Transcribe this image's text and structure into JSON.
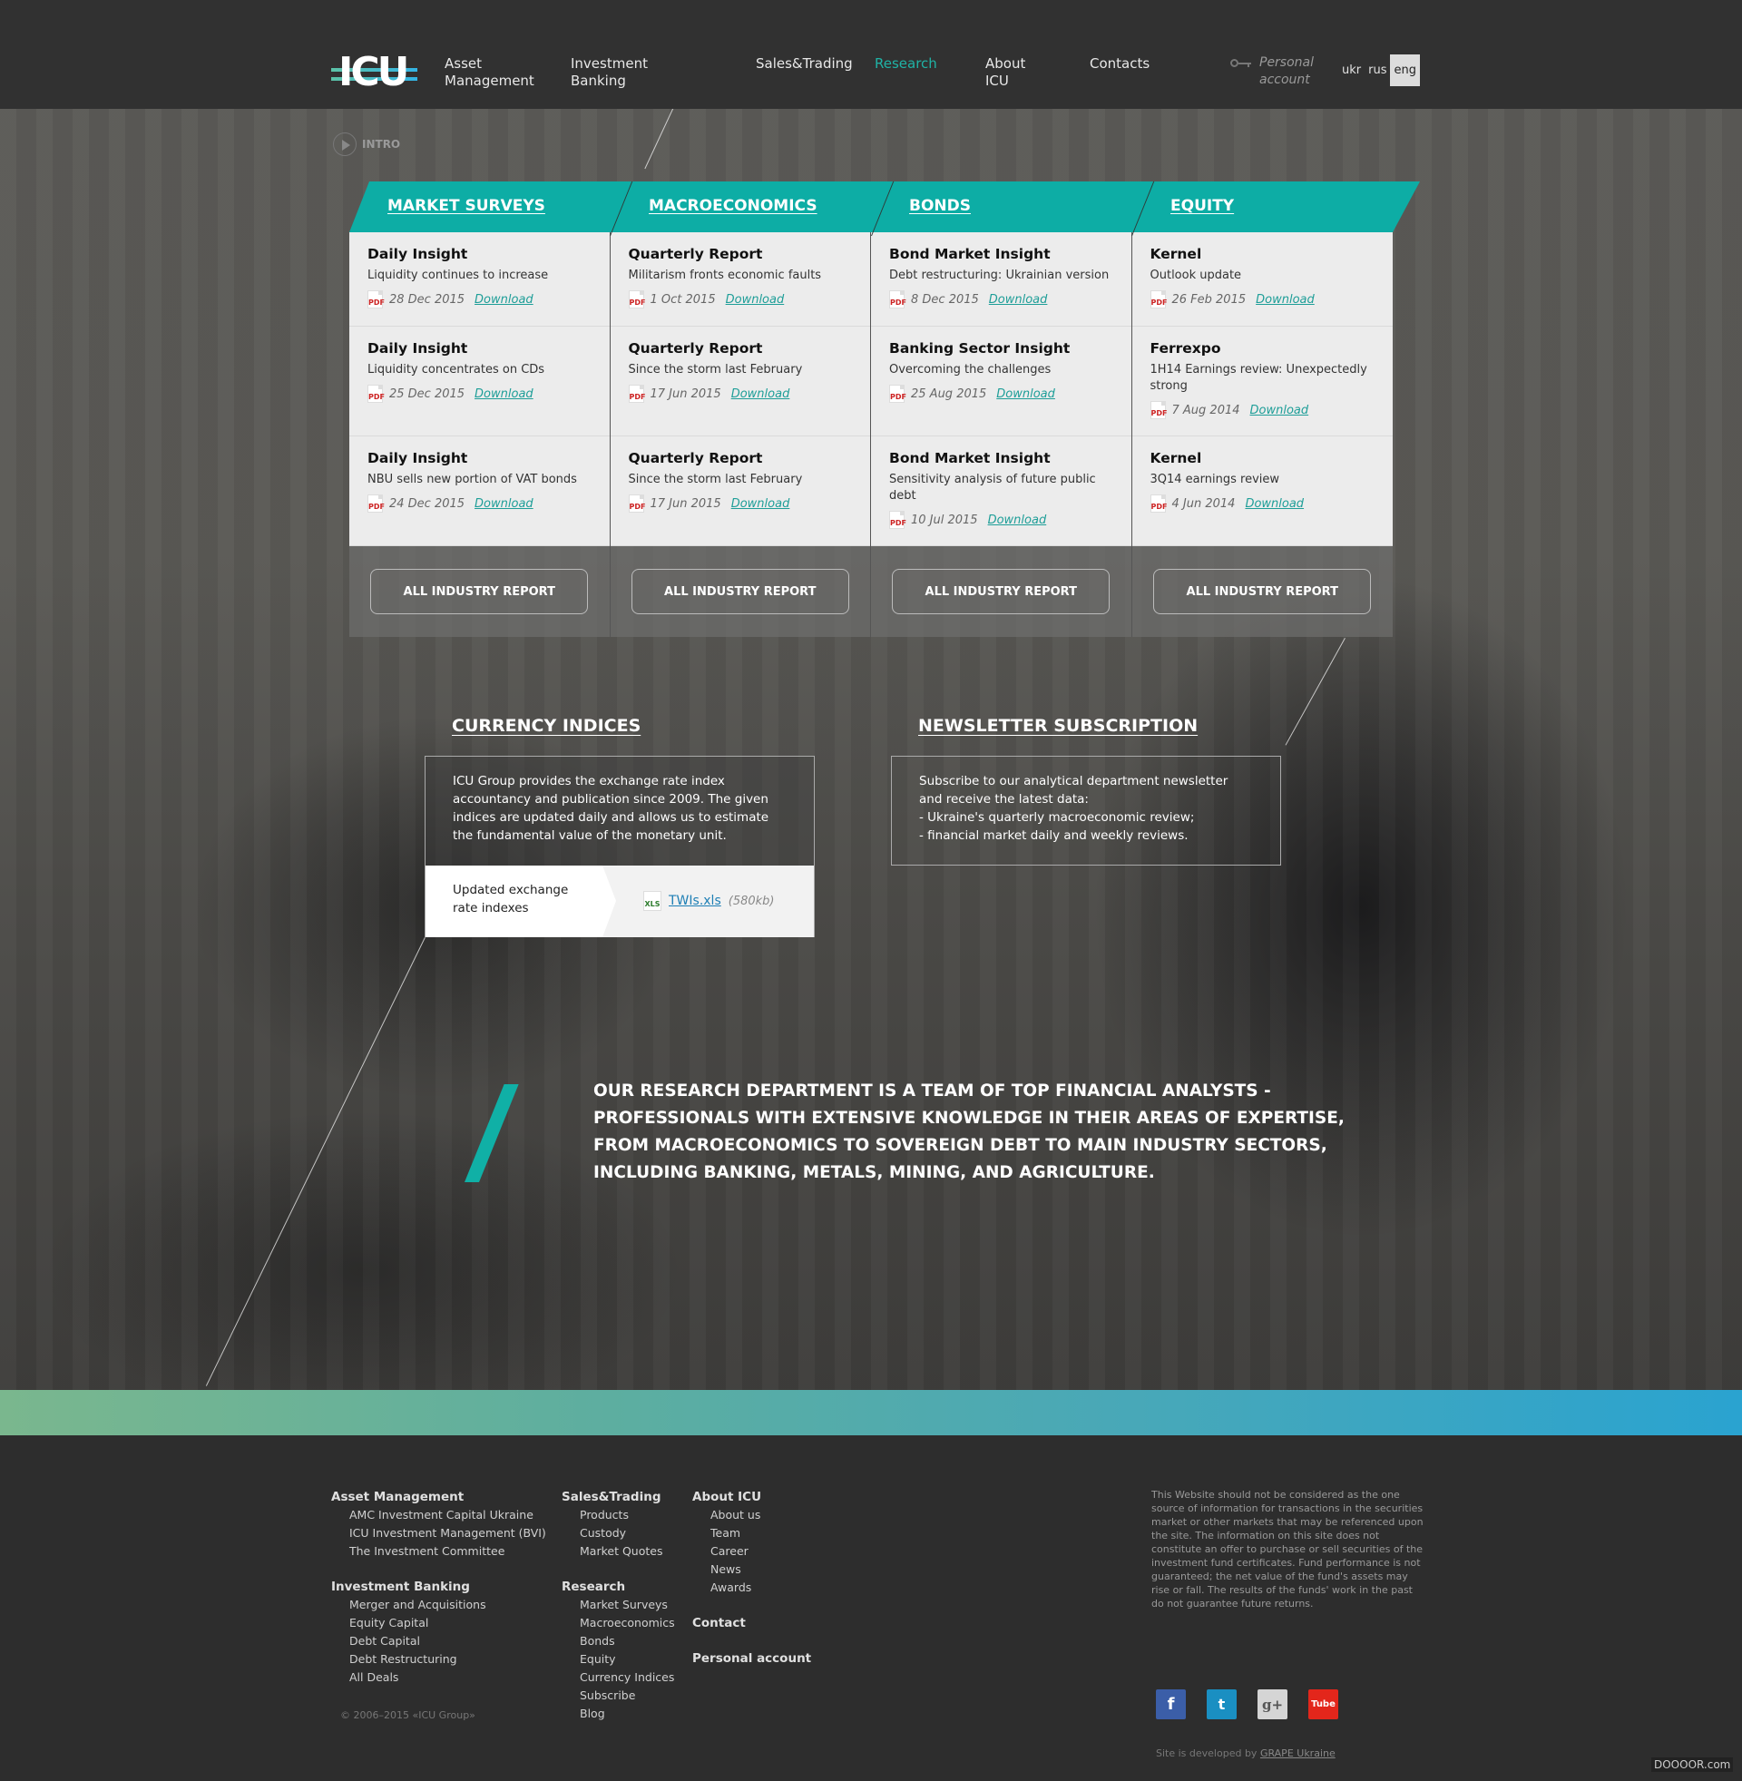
{
  "header": {
    "logo_text": "ICU",
    "nav": [
      {
        "label": "Asset\nManagement",
        "active": false
      },
      {
        "label": "Investment\nBanking",
        "active": false
      },
      {
        "label": "Sales&Trading",
        "active": false
      },
      {
        "label": "Research",
        "active": true
      },
      {
        "label": "About\nICU",
        "active": false
      },
      {
        "label": "Contacts",
        "active": false
      }
    ],
    "personal_account": "Personal\naccount",
    "languages": [
      {
        "label": "ukr",
        "active": false
      },
      {
        "label": "rus",
        "active": false
      },
      {
        "label": "eng",
        "active": true
      }
    ]
  },
  "intro": {
    "label": "INTRO"
  },
  "research": {
    "columns": [
      {
        "title": "MARKET SURVEYS",
        "entries": [
          {
            "title": "Daily Insight",
            "subtitle": "Liquidity continues to increase",
            "date": "28 Dec 2015",
            "link": "Download"
          },
          {
            "title": "Daily Insight",
            "subtitle": "Liquidity concentrates on CDs",
            "date": "25 Dec 2015",
            "link": "Download"
          },
          {
            "title": "Daily Insight",
            "subtitle": "NBU sells new portion of VAT bonds",
            "date": "24 Dec 2015",
            "link": "Download"
          }
        ],
        "button": "ALL INDUSTRY REPORT"
      },
      {
        "title": "MACROECONOMICS",
        "entries": [
          {
            "title": "Quarterly Report",
            "subtitle": "Militarism fronts economic faults",
            "date": "1 Oct 2015",
            "link": "Download"
          },
          {
            "title": "Quarterly Report",
            "subtitle": "Since the storm last February",
            "date": "17 Jun 2015",
            "link": "Download"
          },
          {
            "title": "Quarterly Report",
            "subtitle": "Since the storm last February",
            "date": "17 Jun 2015",
            "link": "Download"
          }
        ],
        "button": "ALL INDUSTRY REPORT"
      },
      {
        "title": "BONDS",
        "entries": [
          {
            "title": "Bond Market Insight",
            "subtitle": "Debt restructuring: Ukrainian version",
            "date": "8 Dec 2015",
            "link": "Download"
          },
          {
            "title": "Banking Sector Insight",
            "subtitle": "Overcoming the challenges",
            "date": "25 Aug 2015",
            "link": "Download"
          },
          {
            "title": "Bond Market Insight",
            "subtitle": "Sensitivity analysis of future public debt",
            "date": "10 Jul 2015",
            "link": "Download"
          }
        ],
        "button": "ALL INDUSTRY REPORT"
      },
      {
        "title": "EQUITY",
        "entries": [
          {
            "title": "Kernel",
            "subtitle": "Outlook update",
            "date": "26 Feb 2015",
            "link": "Download"
          },
          {
            "title": "Ferrexpo",
            "subtitle": "1H14 Earnings review: Unexpectedly strong",
            "date": "7 Aug 2014",
            "link": "Download"
          },
          {
            "title": "Kernel",
            "subtitle": "3Q14 earnings review",
            "date": "4 Jun 2014",
            "link": "Download"
          }
        ],
        "button": "ALL INDUSTRY REPORT"
      }
    ],
    "file_icon": "PDF"
  },
  "currency": {
    "title": "CURRENCY INDICES",
    "text": "ICU Group provides the exchange rate index accountancy and publication since 2009. The given indices are updated daily and allows us to estimate the fundamental value of the monetary unit.",
    "updated_label": "Updated exchange rate indexes",
    "file_icon": "XLS",
    "file_name": "TWIs.xls",
    "file_size": "(580kb)"
  },
  "newsletter": {
    "title": "NEWSLETTER SUBSCRIPTION",
    "text": "Subscribe to our analytical department newsletter and receive the latest data:\n- Ukraine's quarterly macroeconomic review;\n- financial market daily and weekly reviews."
  },
  "quote": "Our research department is a team of top financial analysts - professionals with extensive knowledge in their areas of expertise, from macroeconomics to sovereign debt to main industry sectors, including banking, metals, mining, and agriculture.",
  "footer": {
    "col1": [
      {
        "head": "Asset Management",
        "links": [
          "AMC Investment Capital Ukraine",
          "ICU Investment Management (BVI)",
          "The Investment Committee"
        ]
      },
      {
        "head": "Investment Banking",
        "links": [
          "Merger and Acquisitions",
          "Equity Capital",
          "Debt Capital",
          "Debt Restructuring",
          "All Deals"
        ]
      }
    ],
    "col2": [
      {
        "head": "Sales&Trading",
        "links": [
          "Products",
          "Custody",
          "Market Quotes"
        ]
      },
      {
        "head": "Research",
        "links": [
          "Market Surveys",
          "Macroeconomics",
          "Bonds",
          "Equity",
          "Currency Indices",
          "Subscribe",
          "Blog"
        ]
      }
    ],
    "col3": [
      {
        "head": "About ICU",
        "links": [
          "About us",
          "Team",
          "Career",
          "News",
          "Awards"
        ]
      },
      {
        "head": "Contact",
        "links": []
      },
      {
        "head": "Personal account",
        "links": []
      }
    ],
    "copyright": "© 2006–2015 «ICU Group»",
    "disclaimer": "This Website should not be considered as the one source of information for transactions in the securities market or other markets that may be referenced upon the site. The information on this site does not constitute an offer to purchase or sell securities of the investment fund certificates. Fund performance is not guaranteed; the net value of the fund's assets may rise or fall. The results of the funds' work in the past do not guarantee future returns.",
    "social": [
      {
        "name": "facebook",
        "glyph": "f"
      },
      {
        "name": "twitter",
        "glyph": "t"
      },
      {
        "name": "google-plus",
        "glyph": "g+"
      },
      {
        "name": "youtube",
        "glyph": "Tube"
      }
    ],
    "developed_by": "Site is developed by",
    "developer": "GRAPE Ukraine",
    "watermark": "DOOOOR.com"
  },
  "colors": {
    "accent": "#0dada5",
    "active_nav": "#1fb3a6",
    "band_start": "#7ab78e",
    "band_end": "#2aa3d0"
  }
}
